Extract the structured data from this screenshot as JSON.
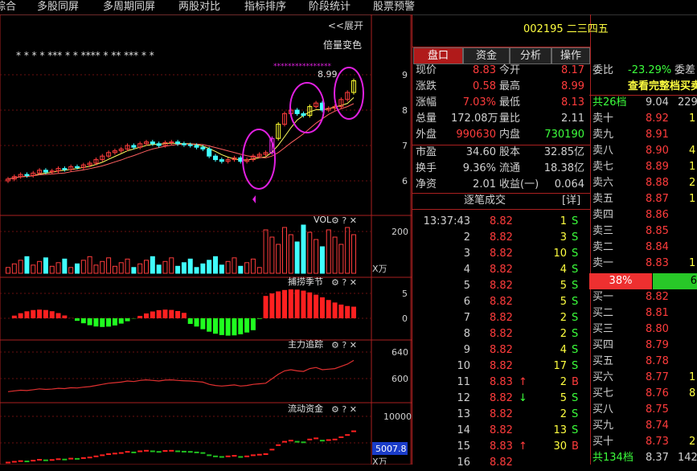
{
  "topbar": [
    "综合",
    "多股同屏",
    "多周期同屏",
    "两股对比",
    "指标排序",
    "阶段统计",
    "股票预警"
  ],
  "chart": {
    "zoom_label": "<<展开",
    "pattern_label": "倍量变色",
    "price_marker": "8.99",
    "main_axis": [
      "9",
      "8",
      "7",
      "6"
    ],
    "vol_title": "VOL",
    "vol_axis": [
      "200"
    ],
    "vol_unit": "X万",
    "ind1_title": "捕捞季节",
    "ind1_axis": [
      "5",
      "0"
    ],
    "ind2_title": "主力追踪",
    "ind2_axis": [
      "640",
      "600"
    ],
    "ind3_title": "流动资金",
    "ind3_axis": [
      "10000",
      "5000"
    ],
    "ind3_value": "5007.8",
    "ind3_unit": "X万",
    "star_row": "* * * * *** * * **** * ** *** * *"
  },
  "chart_data": {
    "type": "candlestick",
    "closes": [
      6.05,
      6.12,
      6.18,
      6.15,
      6.22,
      6.3,
      6.25,
      6.28,
      6.35,
      6.32,
      6.4,
      6.38,
      6.45,
      6.5,
      6.6,
      6.7,
      6.8,
      6.85,
      6.9,
      7.0,
      6.95,
      7.05,
      7.1,
      7.05,
      7.0,
      7.08,
      7.1,
      7.05,
      7.02,
      7.0,
      6.95,
      6.9,
      6.7,
      6.6,
      6.55,
      6.6,
      6.65,
      6.55,
      6.6,
      6.7,
      6.75,
      6.8,
      7.2,
      7.6,
      7.9,
      8.0,
      7.9,
      7.85,
      8.1,
      8.2,
      8.0,
      8.05,
      8.1,
      8.3,
      8.5,
      8.83
    ],
    "series_ma": [
      "MA5",
      "MA10"
    ],
    "ylim": [
      5.8,
      9.2
    ]
  },
  "quote": {
    "code": "002195",
    "name": "二三四五",
    "tabs": [
      "盘口",
      "资金",
      "分析",
      "操作"
    ],
    "rows": [
      {
        "l1": "现价",
        "v1": "8.83",
        "l2": "今开",
        "v2": "8.17",
        "c1": "r",
        "c2": "r"
      },
      {
        "l1": "涨跌",
        "v1": "0.58",
        "l2": "最高",
        "v2": "8.99",
        "c1": "r",
        "c2": "r"
      },
      {
        "l1": "涨幅",
        "v1": "7.03%",
        "l2": "最低",
        "v2": "8.13",
        "c1": "r",
        "c2": "r"
      },
      {
        "l1": "总量",
        "v1": "172.08万",
        "l2": "量比",
        "v2": "2.11",
        "c1": "w",
        "c2": "w"
      },
      {
        "l1": "外盘",
        "v1": "990630",
        "l2": "内盘",
        "v2": "730190",
        "c1": "r",
        "c2": "g"
      }
    ],
    "rows2": [
      {
        "l1": "市盈",
        "v1": "34.60",
        "l2": "股本",
        "v2": "32.85亿"
      },
      {
        "l1": "换手",
        "v1": "9.36%",
        "l2": "流通",
        "v2": "18.38亿"
      },
      {
        "l1": "净资",
        "v1": "2.01",
        "l2": "收益(一)",
        "v2": "0.064"
      }
    ],
    "tick_title": "逐笔成交",
    "tick_detail": "[详]",
    "ticks": [
      {
        "t": "13:37:43",
        "p": "8.82",
        "a": "",
        "v": "1",
        "s": "S"
      },
      {
        "t": "2",
        "p": "8.82",
        "a": "",
        "v": "3",
        "s": "S"
      },
      {
        "t": "3",
        "p": "8.82",
        "a": "",
        "v": "10",
        "s": "S"
      },
      {
        "t": "4",
        "p": "8.82",
        "a": "",
        "v": "4",
        "s": "S"
      },
      {
        "t": "5",
        "p": "8.82",
        "a": "",
        "v": "5",
        "s": "S"
      },
      {
        "t": "6",
        "p": "8.82",
        "a": "",
        "v": "5",
        "s": "S"
      },
      {
        "t": "7",
        "p": "8.82",
        "a": "",
        "v": "2",
        "s": "S"
      },
      {
        "t": "8",
        "p": "8.82",
        "a": "",
        "v": "2",
        "s": "S"
      },
      {
        "t": "9",
        "p": "8.82",
        "a": "",
        "v": "4",
        "s": "S"
      },
      {
        "t": "10",
        "p": "8.82",
        "a": "",
        "v": "17",
        "s": "S"
      },
      {
        "t": "11",
        "p": "8.83",
        "a": "↑",
        "v": "2",
        "s": "B"
      },
      {
        "t": "12",
        "p": "8.82",
        "a": "↓",
        "v": "5",
        "s": "S"
      },
      {
        "t": "13",
        "p": "8.82",
        "a": "",
        "v": "2",
        "s": "S"
      },
      {
        "t": "14",
        "p": "8.82",
        "a": "",
        "v": "13",
        "s": "S"
      },
      {
        "t": "15",
        "p": "8.83",
        "a": "↑",
        "v": "30",
        "s": "B"
      },
      {
        "t": "16",
        "p": "8.82",
        "a": "",
        "v": "",
        "s": ""
      }
    ]
  },
  "level": {
    "weibi_label": "委比",
    "weibi_value": "-23.29%",
    "weicha_label": "委差",
    "full_link": "查看完整档买卖",
    "sell_total": {
      "label": "共26档",
      "price": "9.04",
      "vol": "229"
    },
    "sells": [
      {
        "l": "卖十",
        "p": "8.92",
        "v": "1"
      },
      {
        "l": "卖九",
        "p": "8.91",
        "v": ""
      },
      {
        "l": "卖八",
        "p": "8.90",
        "v": "4"
      },
      {
        "l": "卖七",
        "p": "8.89",
        "v": "1"
      },
      {
        "l": "卖六",
        "p": "8.88",
        "v": "2"
      },
      {
        "l": "卖五",
        "p": "8.87",
        "v": "1"
      },
      {
        "l": "卖四",
        "p": "8.86",
        "v": ""
      },
      {
        "l": "卖三",
        "p": "8.85",
        "v": ""
      },
      {
        "l": "卖二",
        "p": "8.84",
        "v": ""
      },
      {
        "l": "卖一",
        "p": "8.83",
        "v": "1"
      }
    ],
    "ratio_red": "38%",
    "ratio_green": "6",
    "buys": [
      {
        "l": "买一",
        "p": "8.82",
        "v": ""
      },
      {
        "l": "买二",
        "p": "8.81",
        "v": ""
      },
      {
        "l": "买三",
        "p": "8.80",
        "v": ""
      },
      {
        "l": "买四",
        "p": "8.79",
        "v": ""
      },
      {
        "l": "买五",
        "p": "8.78",
        "v": ""
      },
      {
        "l": "买六",
        "p": "8.77",
        "v": "1"
      },
      {
        "l": "买七",
        "p": "8.76",
        "v": "8"
      },
      {
        "l": "买八",
        "p": "8.75",
        "v": ""
      },
      {
        "l": "买九",
        "p": "8.74",
        "v": ""
      },
      {
        "l": "买十",
        "p": "8.73",
        "v": "2"
      }
    ],
    "buy_total": {
      "label": "共134档",
      "price": "8.37",
      "vol": "142"
    }
  }
}
